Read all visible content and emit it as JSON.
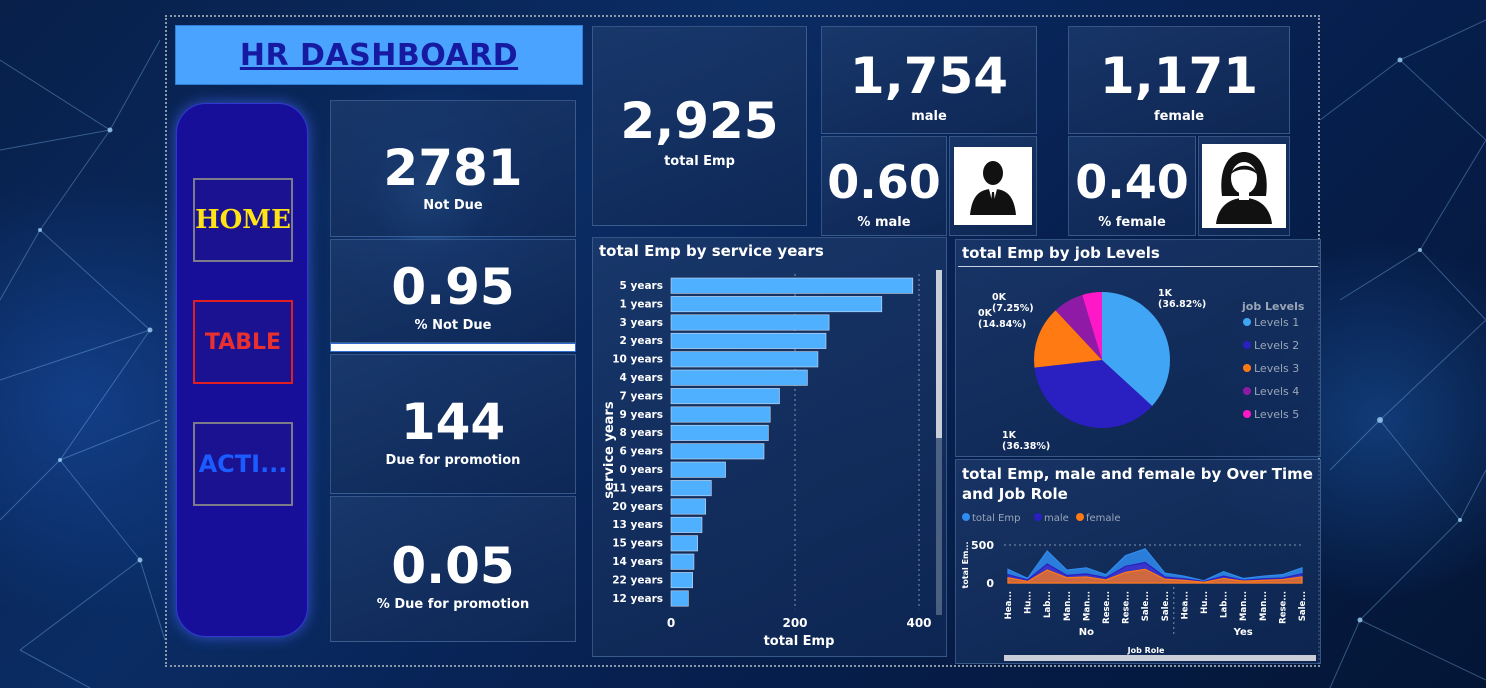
{
  "header": {
    "title": "HR DASHBOARD"
  },
  "nav": {
    "home_label": "HOME",
    "table_label": "TABLE",
    "action_label": "ACTI..."
  },
  "kpis": {
    "not_due": {
      "value": "2781",
      "label": "Not Due"
    },
    "pct_not_due": {
      "value": "0.95",
      "label": "% Not Due"
    },
    "due_promotion": {
      "value": "144",
      "label": "Due for promotion"
    },
    "pct_due_promotion": {
      "value": "0.05",
      "label": "% Due for promotion"
    },
    "total_emp": {
      "value": "2,925",
      "label": "total Emp"
    },
    "male": {
      "value": "1,754",
      "label": "male"
    },
    "female": {
      "value": "1,171",
      "label": "female"
    },
    "pct_male": {
      "value": "0.60",
      "label": "% male"
    },
    "pct_female": {
      "value": "0.40",
      "label": "% female"
    }
  },
  "icons": {
    "male": "male-person-icon",
    "female": "female-person-icon"
  },
  "colors": {
    "bar": "#4fb0ff",
    "accent": "#4aa3ff",
    "nav": "#170f9a"
  },
  "chart_data": [
    {
      "type": "bar",
      "orientation": "horizontal",
      "title": "total Emp by service years",
      "xlabel": "total Emp",
      "ylabel": "service years",
      "categories": [
        "5 years",
        "1 years",
        "3 years",
        "2 years",
        "10 years",
        "4 years",
        "7 years",
        "9 years",
        "8 years",
        "6 years",
        "0 years",
        "11 years",
        "20 years",
        "13 years",
        "15 years",
        "14 years",
        "22 years",
        "12 years"
      ],
      "values": [
        390,
        340,
        255,
        250,
        237,
        220,
        175,
        160,
        157,
        150,
        88,
        65,
        56,
        50,
        43,
        37,
        35,
        28
      ],
      "xlim": [
        0,
        400
      ],
      "xticks": [
        "0",
        "200",
        "400"
      ],
      "grid": true
    },
    {
      "type": "pie",
      "title": "total Emp by job Levels",
      "legend_title": "job Levels",
      "legend_position": "right",
      "categories": [
        "Levels 1",
        "Levels 2",
        "Levels 3",
        "Levels 4",
        "Levels 5"
      ],
      "values": [
        36.82,
        36.38,
        14.84,
        7.25,
        4.71
      ],
      "colors": [
        "#41a5f5",
        "#2a1fc0",
        "#ff7a12",
        "#8e1aa6",
        "#ff18c8"
      ],
      "data_labels": [
        "1K (36.82%)",
        "1K (36.38%)",
        "0K (14.84%)",
        "0K (7.25%)",
        ""
      ]
    },
    {
      "type": "area",
      "title": "total Emp, male and female by Over Time and Job Role",
      "ylabel": "total Em...",
      "xlabel": "Job Role",
      "legend": [
        "total Emp",
        "male",
        "female"
      ],
      "legend_position": "top-left",
      "yticks": [
        "0",
        "500"
      ],
      "ylim": [
        0,
        500
      ],
      "groups": [
        "No",
        "Yes"
      ],
      "categories": [
        "Hea...",
        "Hu...",
        "Lab...",
        "Man...",
        "Man...",
        "Rese...",
        "Rese...",
        "Sale...",
        "Sale...",
        "Hea...",
        "Hu...",
        "Lab...",
        "Man...",
        "Man...",
        "Rese...",
        "Sale..."
      ],
      "series": [
        {
          "name": "total Emp",
          "color": "#2f8cf0",
          "values": [
            180,
            60,
            420,
            170,
            200,
            110,
            360,
            450,
            130,
            90,
            30,
            150,
            60,
            90,
            110,
            200
          ]
        },
        {
          "name": "male",
          "color": "#2a1fc0",
          "values": [
            110,
            40,
            250,
            100,
            120,
            70,
            220,
            270,
            80,
            55,
            20,
            90,
            35,
            55,
            65,
            120
          ]
        },
        {
          "name": "female",
          "color": "#ff7a12",
          "values": [
            70,
            20,
            170,
            70,
            80,
            40,
            140,
            180,
            50,
            35,
            10,
            60,
            25,
            35,
            45,
            80
          ]
        }
      ]
    }
  ]
}
